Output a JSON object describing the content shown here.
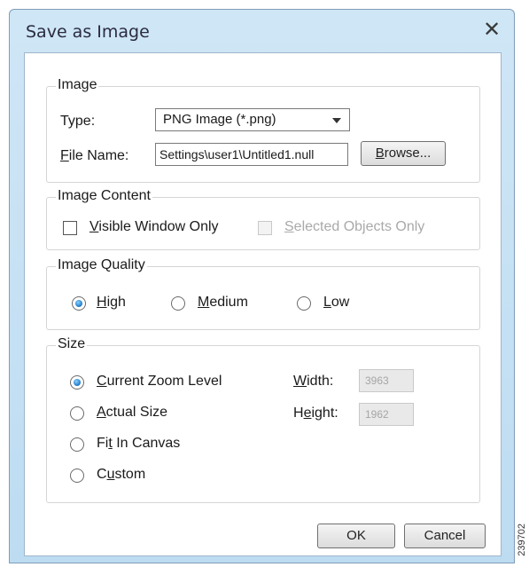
{
  "window": {
    "title": "Save as Image",
    "close_icon": "close-icon"
  },
  "image": {
    "legend": "Image",
    "type_label_pre": "",
    "type_label": "Type:",
    "type_value": "PNG Image (*.png)",
    "filename_label_u": "F",
    "filename_label_rest": "ile Name:",
    "filename_value": "Settings\\user1\\Untitled1.null",
    "browse_u": "B",
    "browse_rest": "rowse..."
  },
  "content": {
    "legend": "Image Content",
    "visible_u": "V",
    "visible_rest": "isible Window Only",
    "visible_checked": false,
    "selected_u": "S",
    "selected_rest": "elected Objects Only",
    "selected_checked": false,
    "selected_disabled": true
  },
  "quality": {
    "legend": "Image Quality",
    "high_u": "H",
    "high_rest": "igh",
    "medium_u": "M",
    "medium_rest": "edium",
    "low_u": "L",
    "low_rest": "ow",
    "selected": "High"
  },
  "size": {
    "legend": "Size",
    "current_u": "C",
    "current_rest": "urrent Zoom Level",
    "actual_u": "A",
    "actual_rest": "ctual Size",
    "fit_pre": "Fi",
    "fit_u": "t",
    "fit_rest": " In Canvas",
    "custom_pre": "C",
    "custom_u": "u",
    "custom_rest": "stom",
    "selected": "Current Zoom Level",
    "width_u": "W",
    "width_rest": "idth:",
    "width_value": "3963",
    "height_pre": "H",
    "height_u": "e",
    "height_rest": "ight:",
    "height_value": "1962"
  },
  "buttons": {
    "ok": "OK",
    "cancel": "Cancel"
  },
  "figure_id": "239702"
}
